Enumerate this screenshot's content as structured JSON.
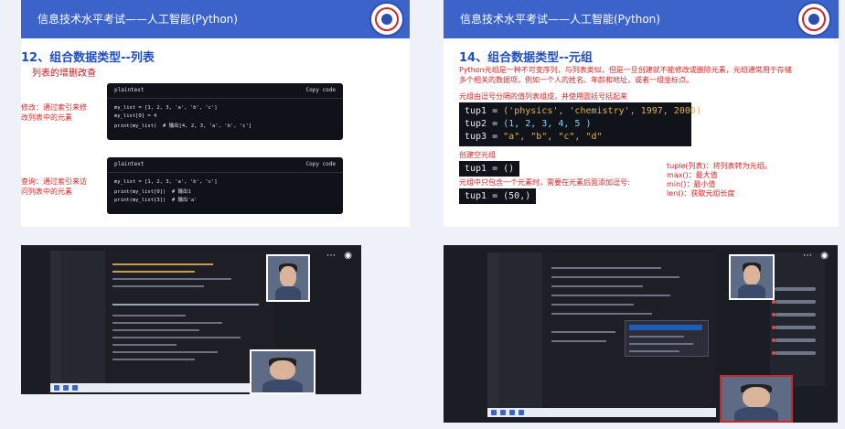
{
  "left_slide": {
    "header": "信息技术水平考试——人工智能(Python)",
    "title": "12、组合数据类型--列表",
    "subtitle": "列表的增删改查",
    "blocks": [
      {
        "label_lines": [
          "修改：通过索引来修",
          "改列表中的元素"
        ],
        "lang": "plaintext",
        "copy": "Copy code",
        "code": [
          "my_list = [1, 2, 3, 'a', 'b', 'c']",
          "my_list[0] = 4",
          "print(my_list)  # 输出[4, 2, 3, 'a', 'b', 'c']"
        ]
      },
      {
        "label_lines": [
          "查询：通过索引来访",
          "问列表中的元素"
        ],
        "lang": "plaintext",
        "copy": "Copy code",
        "code": [
          "my_list = [1, 2, 3, 'a', 'b', 'c']",
          "print(my_list[0])  # 输出1",
          "print(my_list[3])  # 输出'a'"
        ]
      }
    ]
  },
  "right_slide": {
    "header": "信息技术水平考试——人工智能(Python)",
    "title": "14、组合数据类型--元组",
    "intro": [
      "Python元组是一种不可变序列，与列表类似，但是一旦创建就不能修改或删除元素，元组通常用于存储",
      "多个相关的数据项，例如一个人的姓名、年龄和地址，或者一组坐标点。"
    ],
    "note1": "元组由逗号分隔的值列表组成，并使用圆括号括起来",
    "tuples": [
      {
        "name": "tup1",
        "value": "('physics', 'chemistry', 1997, 2000)"
      },
      {
        "name": "tup2",
        "value": "(1, 2, 3, 4, 5 )"
      },
      {
        "name": "tup3",
        "value": "\"a\", \"b\", \"c\", \"d\""
      }
    ],
    "note2": "创建空元组",
    "empty_tuple": "tup1 = ()",
    "note3": "元组中只包含一个元素时，需要在元素后面添加逗号:",
    "single_tuple": "tup1 = (50,)",
    "functions": [
      "tuple(列表)：将列表转为元组。",
      "max()：最大值",
      "min()：最小值",
      "len()：获取元组长度"
    ]
  },
  "colors": {
    "accent": "#3b63c9",
    "red": "#d32727",
    "title_blue": "#1f4fbf"
  }
}
